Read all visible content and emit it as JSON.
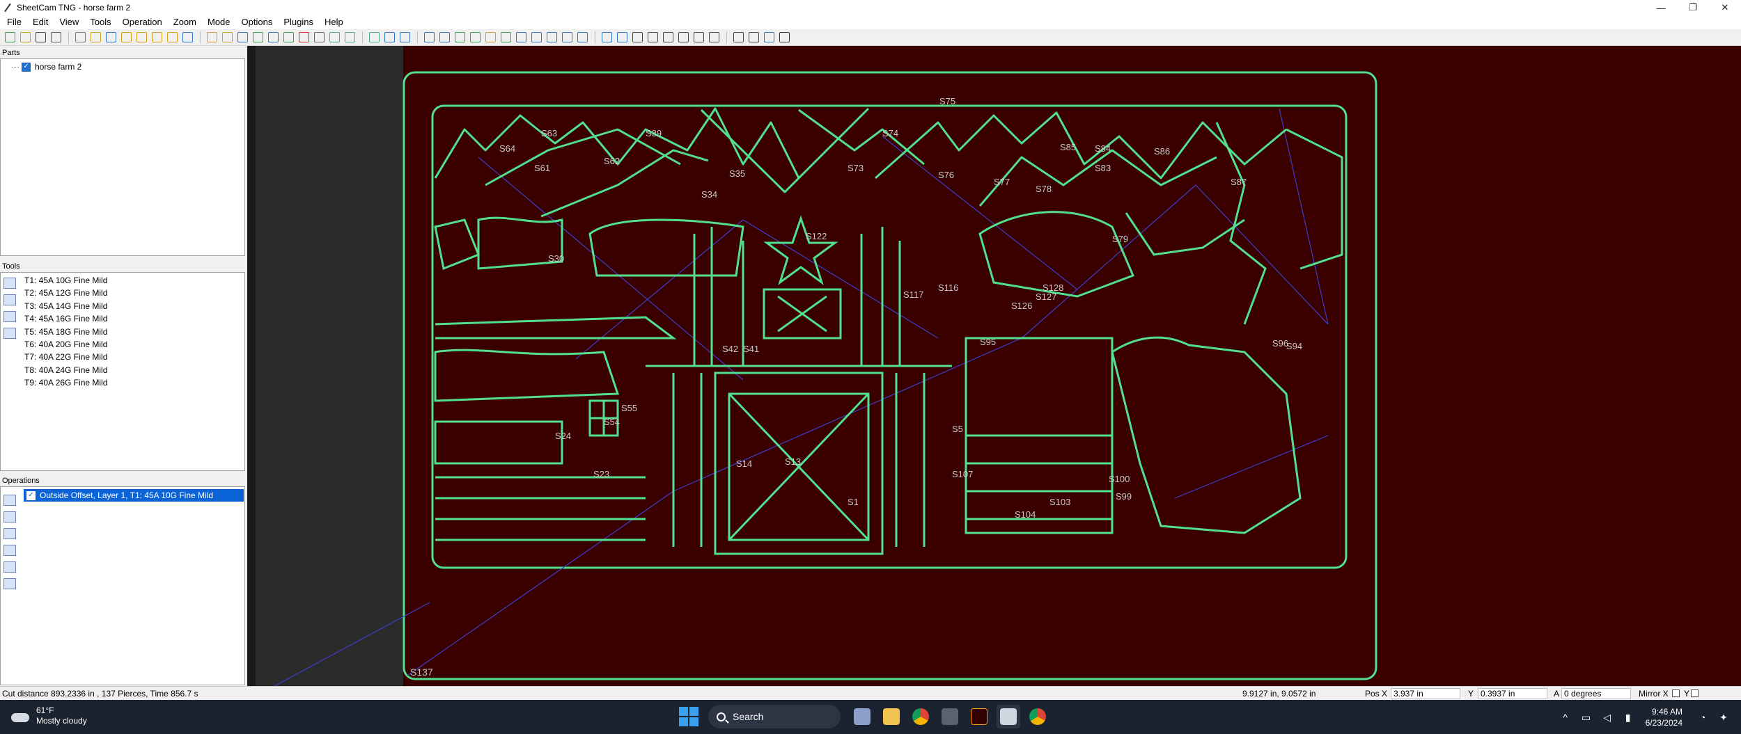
{
  "window": {
    "title": "SheetCam TNG - horse farm 2",
    "controls": [
      "—",
      "❐",
      "✕"
    ]
  },
  "menu": [
    "File",
    "Edit",
    "View",
    "Tools",
    "Operation",
    "Zoom",
    "Mode",
    "Options",
    "Plugins",
    "Help"
  ],
  "panels": {
    "parts": {
      "header": "Parts",
      "items": [
        {
          "label": "horse farm 2",
          "checked": true
        }
      ]
    },
    "tools": {
      "header": "Tools",
      "items": [
        "T1: 45A 10G Fine Mild",
        "T2: 45A 12G Fine Mild",
        "T3: 45A 14G Fine Mild",
        "T4: 45A 16G Fine Mild",
        "T5: 45A 18G Fine Mild",
        "T6: 40A 20G Fine Mild",
        "T7: 40A 22G Fine Mild",
        "T8: 40A 24G Fine Mild",
        "T9: 40A 26G Fine Mild"
      ]
    },
    "operations": {
      "header": "Operations",
      "items": [
        {
          "label": "Outside Offset, Layer 1, T1: 45A 10G Fine Mild",
          "checked": true,
          "selected": true
        }
      ]
    }
  },
  "canvas": {
    "background": "#3a0000",
    "outline_color": "#52e08f",
    "rapid_color": "#3b3fc8",
    "start_label": "S137",
    "sample_labels": [
      "S75",
      "S63",
      "S64",
      "S61",
      "S62",
      "S39",
      "S35",
      "S34",
      "S74",
      "S73",
      "S76",
      "S77",
      "S78",
      "S85",
      "S84",
      "S83",
      "S86",
      "S87",
      "S30",
      "S122",
      "S116",
      "S117",
      "S126",
      "S127",
      "S128",
      "S79",
      "S55",
      "S54",
      "S24",
      "S23",
      "S14",
      "S13",
      "S1",
      "S5",
      "S107",
      "S100",
      "S99",
      "S104",
      "S103",
      "S94",
      "S95",
      "S41",
      "S42",
      "S96"
    ]
  },
  "status": {
    "cut_info": "Cut distance 893.2336 in , 137 Pierces, Time 856.7 s",
    "cursor": "9.9127 in, 9.0572 in",
    "pos_x_label": "Pos X",
    "pos_x": "3.937 in",
    "pos_y_label": "Y",
    "pos_y": "0.3937 in",
    "angle_label": "A",
    "angle": "0 degrees",
    "mirror_x": "Mirror X",
    "mirror_y": "Y"
  },
  "taskbar": {
    "weather_temp": "61°F",
    "weather_desc": "Mostly cloudy",
    "search_label": "Search",
    "time": "9:46 AM",
    "date": "6/23/2024"
  }
}
